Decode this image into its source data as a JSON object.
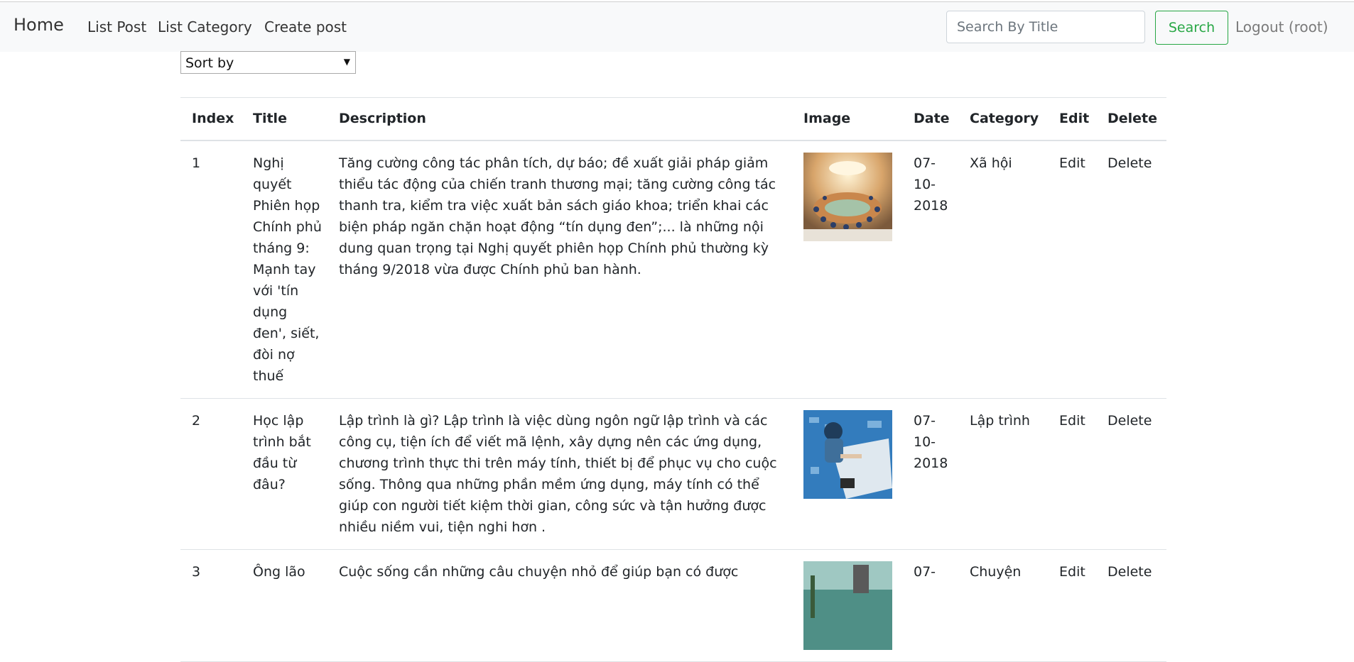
{
  "navbar": {
    "brand": "Home",
    "links": [
      "List Post",
      "List Category",
      "Create post"
    ],
    "search_placeholder": "Search By Title",
    "search_button": "Search",
    "logout": "Logout (root)"
  },
  "sort": {
    "label": "Sort by"
  },
  "table": {
    "headers": [
      "Index",
      "Title",
      "Description",
      "Image",
      "Date",
      "Category",
      "Edit",
      "Delete"
    ],
    "rows": [
      {
        "index": "1",
        "title": "Nghị quyết Phiên họp Chính phủ tháng 9: Mạnh tay với 'tín dụng đen', siết, đòi nợ thuế",
        "description": "Tăng cường công tác phân tích, dự báo; đề xuất giải pháp giảm thiểu tác động của chiến tranh thương mại; tăng cường công tác thanh tra, kiểm tra việc xuất bản sách giáo khoa; triển khai các biện pháp ngăn chặn hoạt động “tín dụng đen”;... là những nội dung quan trọng tại Nghị quyết phiên họp Chính phủ thường kỳ tháng 9/2018 vừa được Chính phủ ban hành.",
        "image": "meeting-hall-photo",
        "date": "07-10-2018",
        "category": "Xã hội",
        "edit": "Edit",
        "delete": "Delete"
      },
      {
        "index": "2",
        "title": "Học lập trình bắt đầu từ đâu?",
        "description": "Lập trình là gì? Lập trình là việc dùng ngôn ngữ lập trình và các công cụ, tiện ích để viết mã lệnh, xây dựng nên các ứng dụng, chương trình thực thi trên máy tính, thiết bị để phục vụ cho cuộc sống. Thông qua những phần mềm ứng dụng, máy tính có thể giúp con người tiết kiệm thời gian, công sức và tận hưởng được nhiều niềm vui, tiện nghi hơn .",
        "image": "programmer-desk-photo",
        "date": "07-10-2018",
        "category": "Lập trình",
        "edit": "Edit",
        "delete": "Delete"
      },
      {
        "index": "3",
        "title": "Ông lão",
        "description": "Cuộc sống cần những câu chuyện nhỏ để giúp bạn có được",
        "image": "beach-photo",
        "date": "07-",
        "category": "Chuyện",
        "edit": "Edit",
        "delete": "Delete"
      }
    ]
  }
}
